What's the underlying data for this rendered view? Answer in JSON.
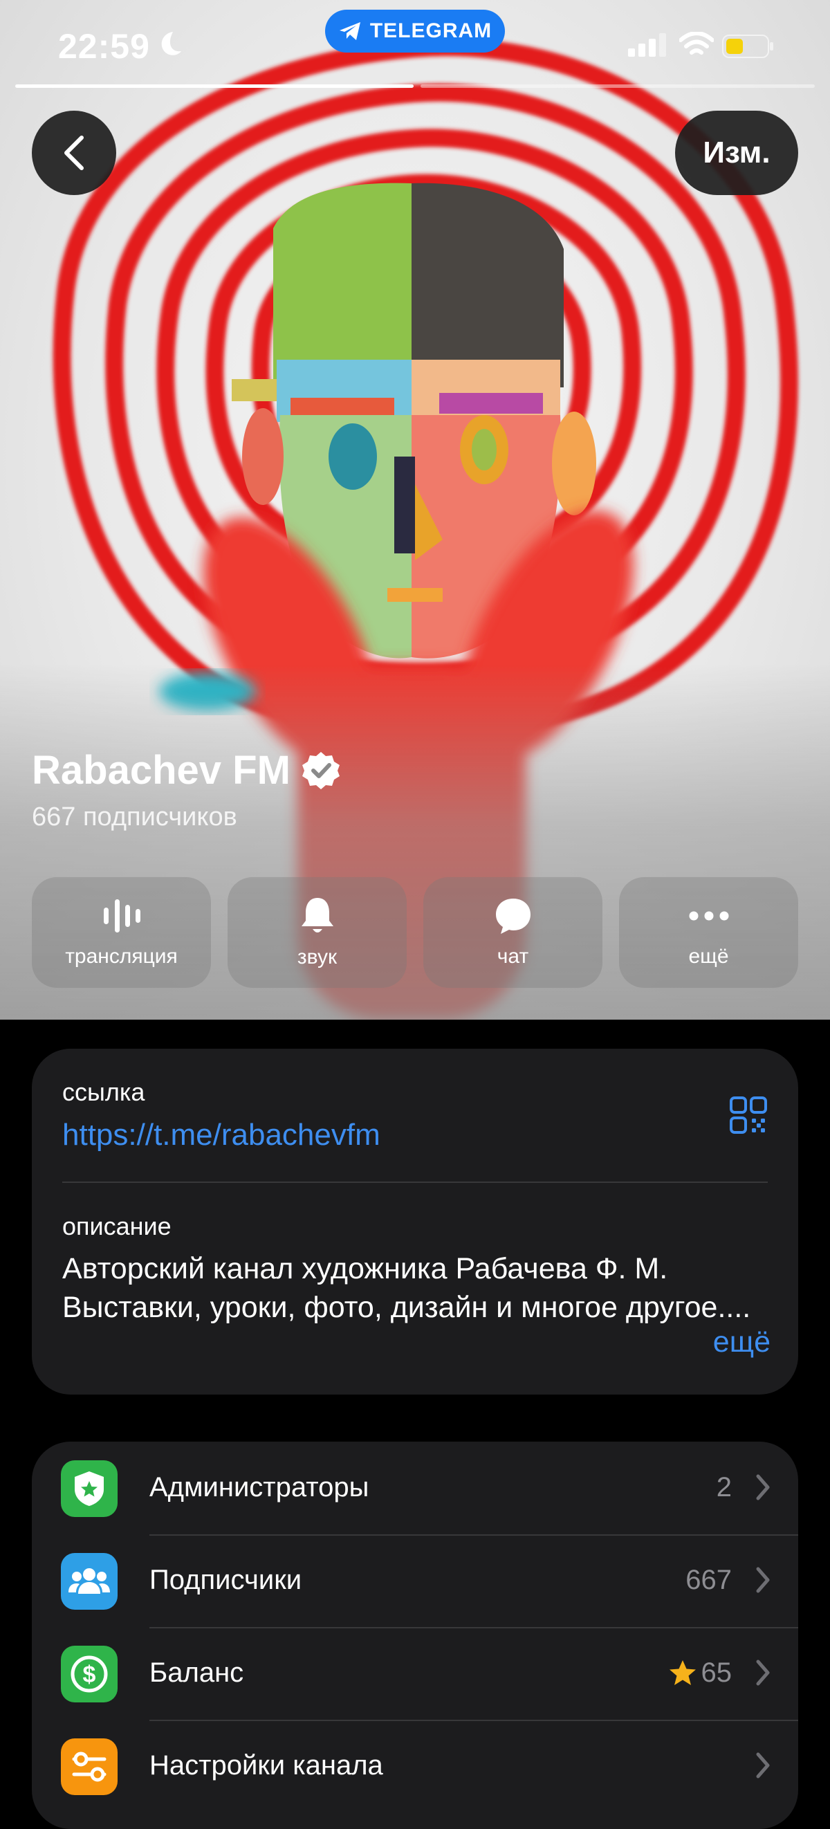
{
  "status": {
    "time": "22:59",
    "pill": "TELEGRAM"
  },
  "header": {
    "edit": "Изм."
  },
  "channel": {
    "name": "Rabachev FM",
    "subscribers": "667 подписчиков"
  },
  "actions": [
    {
      "label": "трансляция",
      "icon": "broadcast-icon"
    },
    {
      "label": "звук",
      "icon": "bell-icon"
    },
    {
      "label": "чат",
      "icon": "chat-bubble-icon"
    },
    {
      "label": "ещё",
      "icon": "more-dots-icon"
    }
  ],
  "info": {
    "link_label": "ссылка",
    "link": "https://t.me/rabachevfm",
    "desc_label": "описание",
    "description": "Авторский канал художника Рабачева Ф. М. Выставки, уроки, фото, дизайн и многое другое....",
    "more": "ещё"
  },
  "rows": [
    {
      "label": "Администраторы",
      "value": "2",
      "icon": "admin-shield-icon",
      "color": "#2fb44a"
    },
    {
      "label": "Подписчики",
      "value": "667",
      "icon": "subscribers-icon",
      "color": "#2e9fe6"
    },
    {
      "label": "Баланс",
      "value": "65",
      "icon": "balance-icon",
      "color": "#2fb44a"
    },
    {
      "label": "Настройки канала",
      "value": "",
      "icon": "channel-settings-icon",
      "color": "#f7950e"
    }
  ],
  "colors": {
    "accent": "#3e8ef0",
    "telegram_blue": "#1a7cf3",
    "card": "#1c1c1e"
  }
}
